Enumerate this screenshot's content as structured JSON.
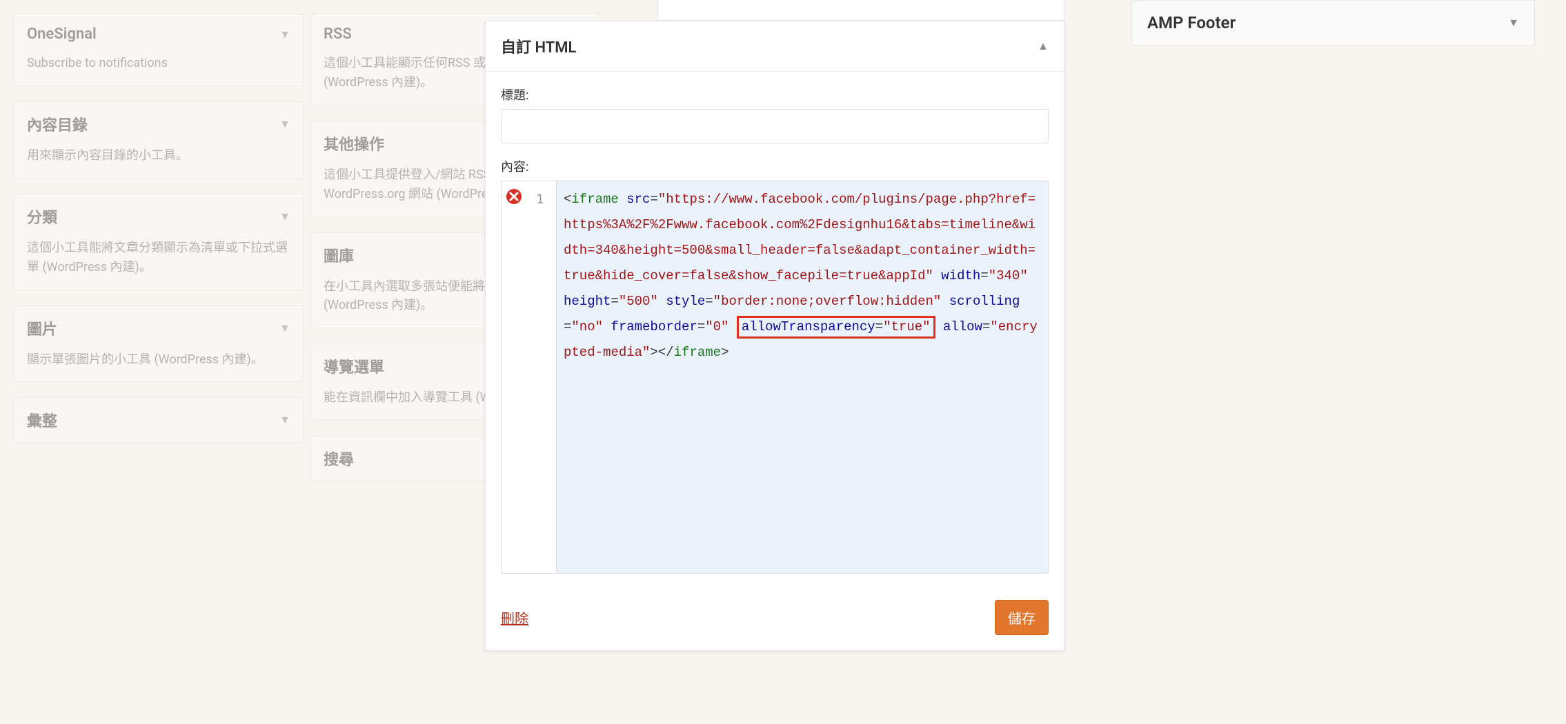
{
  "left_col": [
    {
      "title": "OneSignal",
      "desc": "Subscribe to notifications",
      "has_chevron": true
    },
    {
      "title": "內容目錄",
      "desc": "用來顯示內容目錄的小工具。",
      "has_chevron": true
    },
    {
      "title": "分類",
      "desc": "這個小工具能將文章分類顯示為清單或下拉式選單 (WordPress 內建)。",
      "has_chevron": true
    },
    {
      "title": "圖片",
      "desc": "顯示單張圖片的小工具 (WordPress 內建)。",
      "has_chevron": true
    },
    {
      "title": "彙整",
      "desc": "",
      "has_chevron": true
    }
  ],
  "left_col2": [
    {
      "title": "RSS",
      "desc": "這個小工具能顯示任何RSS 或 Atom 資訊提供 (WordPress 內建)。",
      "has_chevron": false
    },
    {
      "title": "其他操作",
      "desc": "這個小工具提供登入/網站 RSS 資訊提供及 WordPress.org 網站 (WordPress 內建)。",
      "has_chevron": false
    },
    {
      "title": "圖庫",
      "desc": "在小工具內選取多張站便能將這些圖片以圖庫 (WordPress 內建)。",
      "has_chevron": false
    },
    {
      "title": "導覽選單",
      "desc": "能在資訊欄中加入導覽工具 (WordPress 內建)",
      "has_chevron": false
    },
    {
      "title": "搜尋",
      "desc": "",
      "has_chevron": false
    }
  ],
  "editor": {
    "title": "自訂 HTML",
    "label_title": "標題:",
    "label_content": "內容:",
    "title_value": "",
    "line_number": "1",
    "delete_label": "刪除",
    "save_label": "儲存",
    "code": {
      "tag_open": "iframe",
      "attr_src": "src",
      "val_src": "\"https://www.facebook.com/plugins/page.php?href=https%3A%2F%2Fwww.facebook.com%2Fdesignhu16&tabs=timeline&width=340&height=500&small_header=false&adapt_container_width=true&hide_cover=false&show_facepile=true&appId\"",
      "attr_width": "width",
      "val_width": "\"340\"",
      "attr_height": "height",
      "val_height": "\"500\"",
      "attr_style": "style",
      "val_style": "\"border:none;overflow:hidden\"",
      "attr_scrolling": "scrolling",
      "val_scrolling": "\"no\"",
      "attr_frameborder": "frameborder",
      "val_frameborder": "\"0\"",
      "attr_allowtrans": "allowTransparency",
      "val_allowtrans": "\"true\"",
      "attr_allow": "allow",
      "val_allow": "\"encrypted-media\"",
      "tag_close": "iframe"
    }
  },
  "right_panel": {
    "title": "AMP Footer"
  }
}
